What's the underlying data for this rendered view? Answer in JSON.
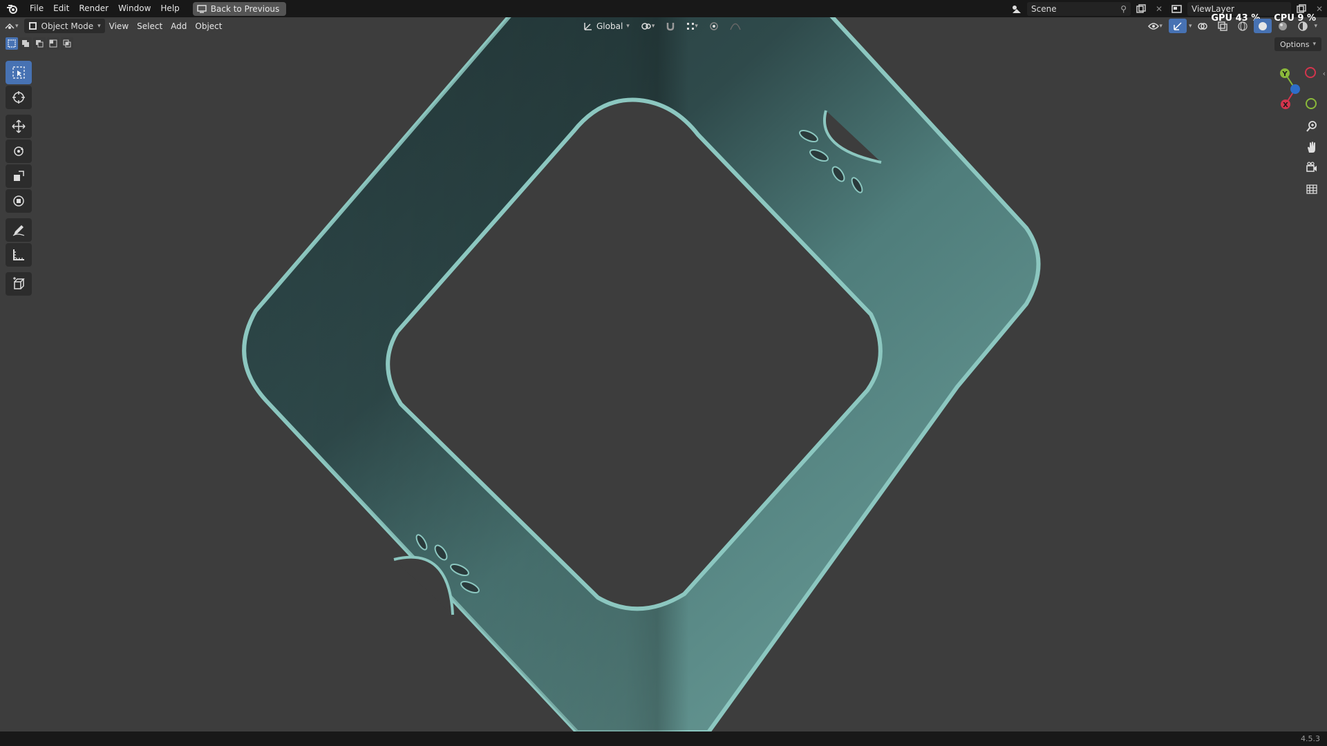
{
  "menu": {
    "items": [
      "File",
      "Edit",
      "Render",
      "Window",
      "Help"
    ],
    "back_button": "Back to Previous"
  },
  "scene": {
    "label": "Scene"
  },
  "viewlayer": {
    "label": "ViewLayer"
  },
  "stats": {
    "gpu": "GPU 43 %",
    "cpu": "CPU 9 %"
  },
  "header": {
    "mode": "Object Mode",
    "view": "View",
    "select": "Select",
    "add": "Add",
    "object": "Object",
    "orientation": "Global"
  },
  "options": {
    "label": "Options"
  },
  "gizmo": {
    "x": "X",
    "y": "Y"
  },
  "status": {
    "version": "4.5.3"
  },
  "colors": {
    "accent": "#4772b3",
    "object_base": "#4e7b78",
    "object_edge": "#8cc7c0",
    "background": "#3d3d3d"
  }
}
